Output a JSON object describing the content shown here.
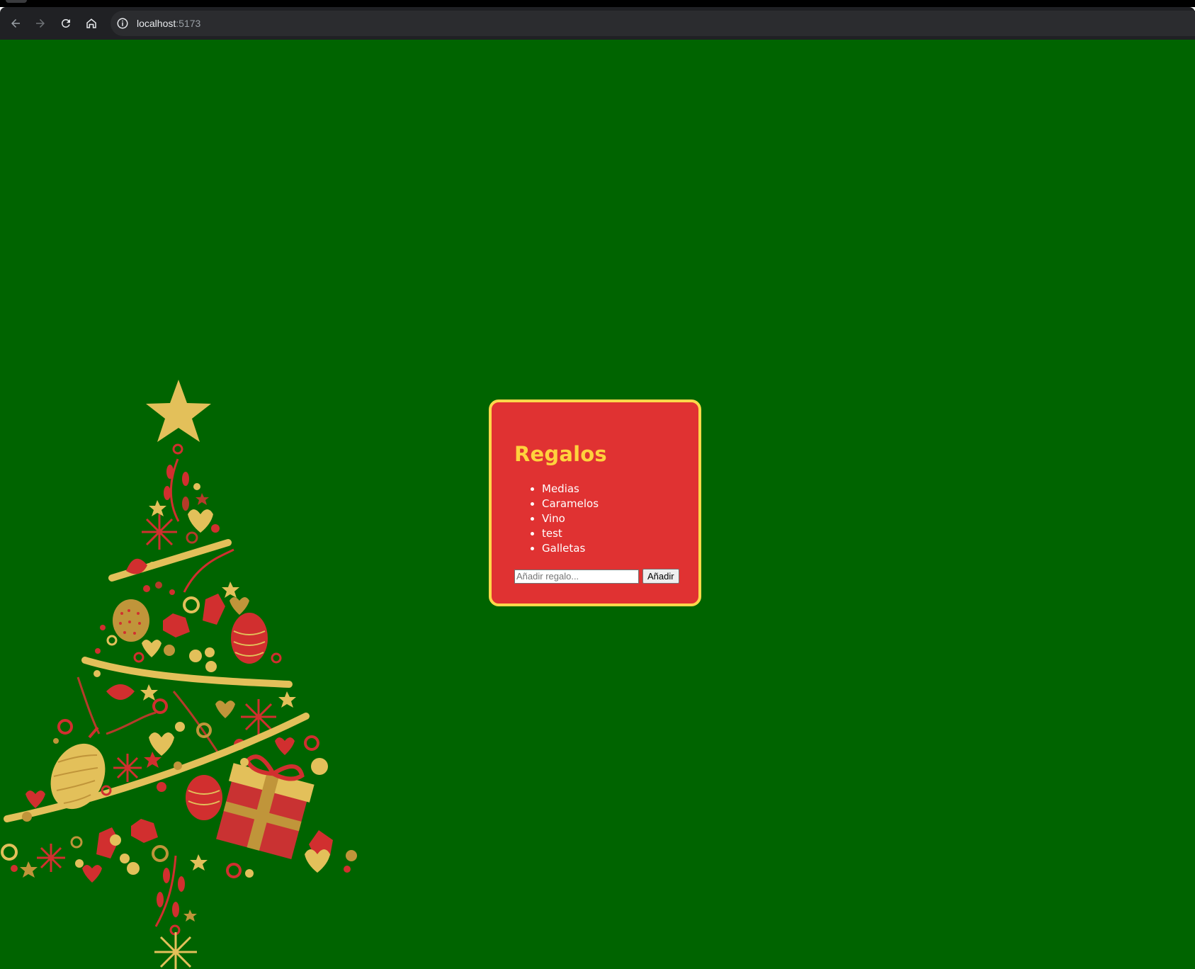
{
  "browser": {
    "url_host": "localhost",
    "url_port": ":5173",
    "icons": [
      "back-arrow-icon",
      "forward-arrow-icon",
      "reload-icon",
      "home-icon",
      "site-info-icon"
    ]
  },
  "page": {
    "background_color": "#006400",
    "illustration": "christmas-tree",
    "card": {
      "background_color": "#e03232",
      "border_color": "#ffd84a",
      "title": "Regalos",
      "items": [
        "Medias",
        "Caramelos",
        "Vino",
        "test",
        "Galletas"
      ],
      "input_placeholder": "Añadir regalo...",
      "input_value": "",
      "add_button_label": "Añadir"
    }
  }
}
